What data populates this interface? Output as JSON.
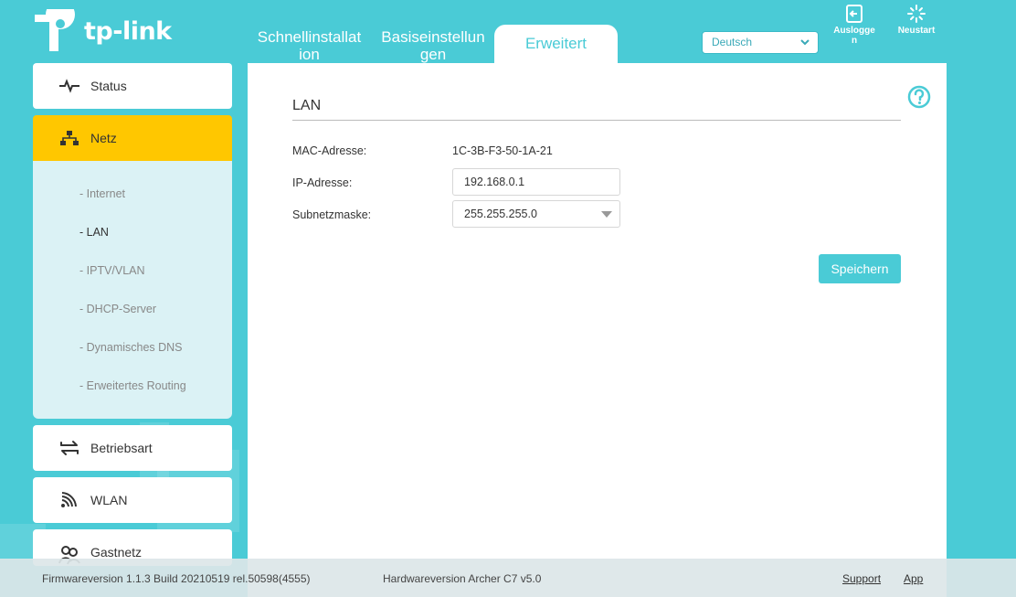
{
  "brand": {
    "name": "tp-link"
  },
  "tabs": [
    {
      "label": "Schnellinstallat ion"
    },
    {
      "label": "Basiseinstellun gen"
    },
    {
      "label": "Erweitert"
    }
  ],
  "language": {
    "selected": "Deutsch"
  },
  "header_actions": {
    "logout": "Ausloggen",
    "reboot": "Neustart"
  },
  "sidebar": {
    "items": [
      {
        "label": "Status",
        "icon": "pulse-icon"
      },
      {
        "label": "Netz",
        "icon": "network-icon"
      },
      {
        "label": "Betriebsart",
        "icon": "swap-icon"
      },
      {
        "label": "WLAN",
        "icon": "wifi-icon"
      },
      {
        "label": "Gastnetz",
        "icon": "guests-icon"
      }
    ],
    "submenu": [
      "- Internet",
      "- LAN",
      "- IPTV/VLAN",
      "- DHCP-Server",
      "- Dynamisches DNS",
      "- Erweitertes Routing"
    ]
  },
  "main": {
    "title": "LAN",
    "mac_label": "MAC-Adresse:",
    "mac_value": "1C-3B-F3-50-1A-21",
    "ip_label": "IP-Adresse:",
    "ip_value": "192.168.0.1",
    "subnet_label": "Subnetzmaske:",
    "subnet_value": "255.255.255.0",
    "save_label": "Speichern"
  },
  "footer": {
    "firmware": "Firmwareversion 1.1.3 Build 20210519 rel.50598(4555)",
    "hardware": "Hardwareversion Archer C7 v5.0",
    "support": "Support",
    "app": "App"
  },
  "colors": {
    "accent": "#4acbd6",
    "active": "#ffc700",
    "submenu_bg": "#dbf2f5"
  }
}
